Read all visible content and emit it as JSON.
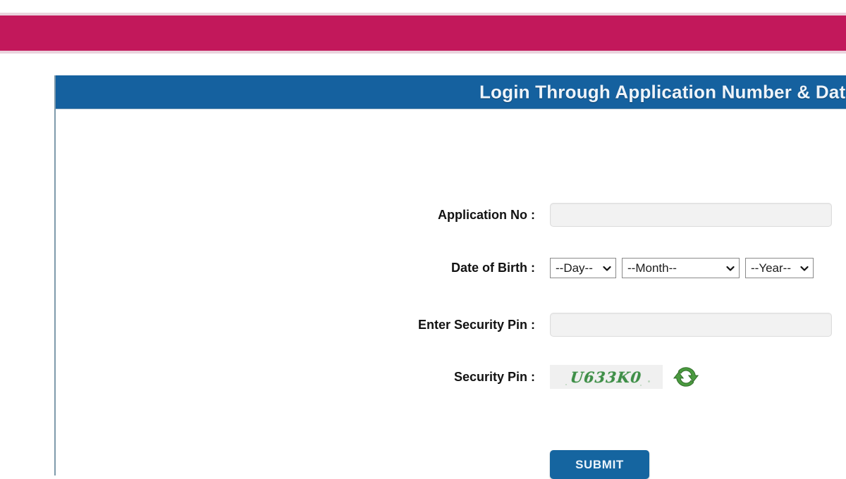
{
  "theme": {
    "banner_color": "#c2185b",
    "banner_border_color": "#ead3dd",
    "panel_header_color": "#15619f",
    "submit_color": "#1565a0",
    "captcha_text_color": "#3f8f48",
    "refresh_icon_color": "#4a9a3f"
  },
  "panel": {
    "header_title": "Login Through Application Number & Date"
  },
  "form": {
    "application_no": {
      "label": "Application No :",
      "value": "",
      "placeholder": ""
    },
    "date_of_birth": {
      "label": "Date of Birth :",
      "day": {
        "selected": "--Day--",
        "options": [
          "--Day--"
        ]
      },
      "month": {
        "selected": "--Month--",
        "options": [
          "--Month--"
        ]
      },
      "year": {
        "selected": "--Year--",
        "options": [
          "--Year--"
        ]
      }
    },
    "enter_security_pin": {
      "label": "Enter Security Pin :",
      "value": "",
      "placeholder": ""
    },
    "security_pin": {
      "label": "Security Pin :",
      "captcha_text": "U633K0",
      "refresh_icon": "refresh-icon"
    },
    "submit": {
      "label": "SUBMIT"
    }
  }
}
